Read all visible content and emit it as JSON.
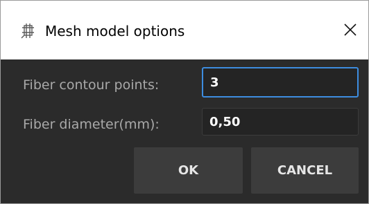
{
  "window": {
    "title": "Mesh model options",
    "icon": "mesh-app-icon",
    "close_icon": "close-icon"
  },
  "form": {
    "contour_label": "Fiber contour points:",
    "contour_value": "3",
    "diameter_label": "Fiber diameter(mm):",
    "diameter_value": "0,50"
  },
  "buttons": {
    "ok_label": "OK",
    "cancel_label": "CANCEL"
  },
  "colors": {
    "background": "#2b2b2b",
    "focus_border": "#3d8de0",
    "label": "#a9a9a9",
    "button": "#3c3c3c"
  }
}
